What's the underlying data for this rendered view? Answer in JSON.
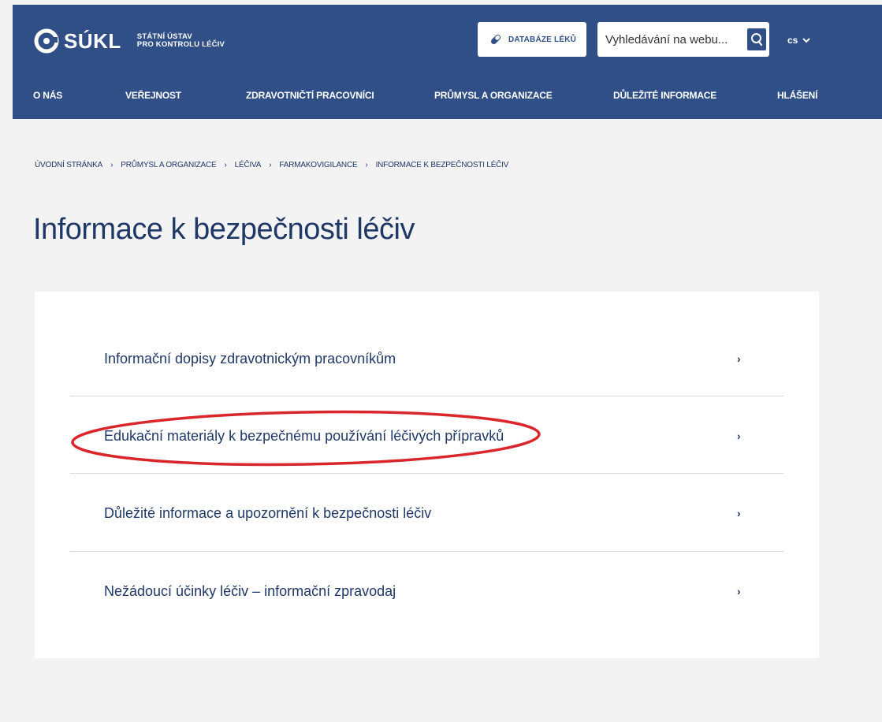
{
  "header": {
    "logo_text": "SÚKL",
    "logo_sub_line1": "STÁTNÍ ÚSTAV",
    "logo_sub_line2": "PRO KONTROLU LÉČIV",
    "database_button": "DATABÁZE LÉKŮ",
    "search_placeholder": "Vyhledávání na webu...",
    "language": "cs",
    "icons": {
      "logo": "sukl-logo-icon",
      "database": "pill-icon",
      "search": "search-icon",
      "language": "chevron-down-icon"
    },
    "nav": [
      {
        "label": "O NÁS"
      },
      {
        "label": "VEŘEJNOST"
      },
      {
        "label": "ZDRAVOTNIČTÍ PRACOVNÍCI"
      },
      {
        "label": "PRŮMYSL A ORGANIZACE"
      },
      {
        "label": "DŮLEŽITÉ INFORMACE"
      },
      {
        "label": "HLÁŠENÍ"
      }
    ]
  },
  "breadcrumb": [
    "ÚVODNÍ STRÁNKA",
    "PRŮMYSL A ORGANIZACE",
    "LÉČIVA",
    "FARMAKOVIGILANCE",
    "INFORMACE K BEZPEČNOSTI LÉČIV"
  ],
  "breadcrumb_separator": "›",
  "page_title": "Informace k bezpečnosti léčiv",
  "links": [
    {
      "label": "Informační dopisy zdravotnickým pracovníkům",
      "chevron": "›"
    },
    {
      "label": "Edukační materiály k bezpečnému používání léčivých přípravků",
      "chevron": "›"
    },
    {
      "label": "Důležité informace a upozornění k bezpečnosti léčiv",
      "chevron": "›"
    },
    {
      "label": "Nežádoucí účinky léčiv – informační zpravodaj",
      "chevron": "›"
    }
  ],
  "colors": {
    "header_bg": "#2f4f86",
    "text": "#1f3867",
    "highlight_ellipse": "#d9262b",
    "page_bg": "#f3f3f3"
  }
}
